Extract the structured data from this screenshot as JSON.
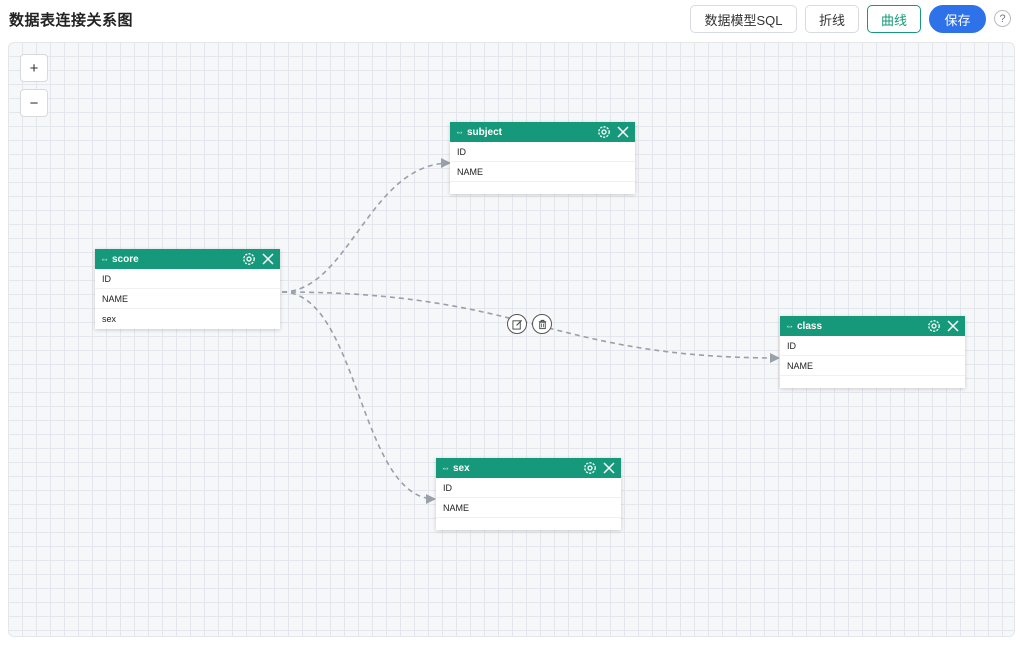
{
  "header": {
    "title": "数据表连接关系图",
    "buttons": {
      "sql": "数据模型SQL",
      "polyline": "折线",
      "curve": "曲线",
      "save": "保存"
    },
    "help": "?"
  },
  "canvas": {
    "zoom_in": "+",
    "zoom_out": "−"
  },
  "colors": {
    "node_header": "#16997a",
    "save_button": "#2d72e8",
    "edge": "#9aa0a8"
  },
  "tables": {
    "subject": {
      "name": "subject",
      "fields": [
        "ID",
        "NAME"
      ]
    },
    "score": {
      "name": "score",
      "fields": [
        "ID",
        "NAME",
        "sex"
      ]
    },
    "class": {
      "name": "class",
      "fields": [
        "ID",
        "NAME"
      ]
    },
    "sex": {
      "name": "sex",
      "fields": [
        "ID",
        "NAME"
      ]
    }
  },
  "relations": [
    {
      "from": "score",
      "to": "subject"
    },
    {
      "from": "score",
      "to": "class"
    },
    {
      "from": "score",
      "to": "sex"
    }
  ],
  "icons": {
    "node_link": "link-arrows-icon",
    "node_settings": "gear-icon",
    "node_close": "close-icon",
    "edge_edit": "edit-icon",
    "edge_delete": "trash-icon"
  }
}
